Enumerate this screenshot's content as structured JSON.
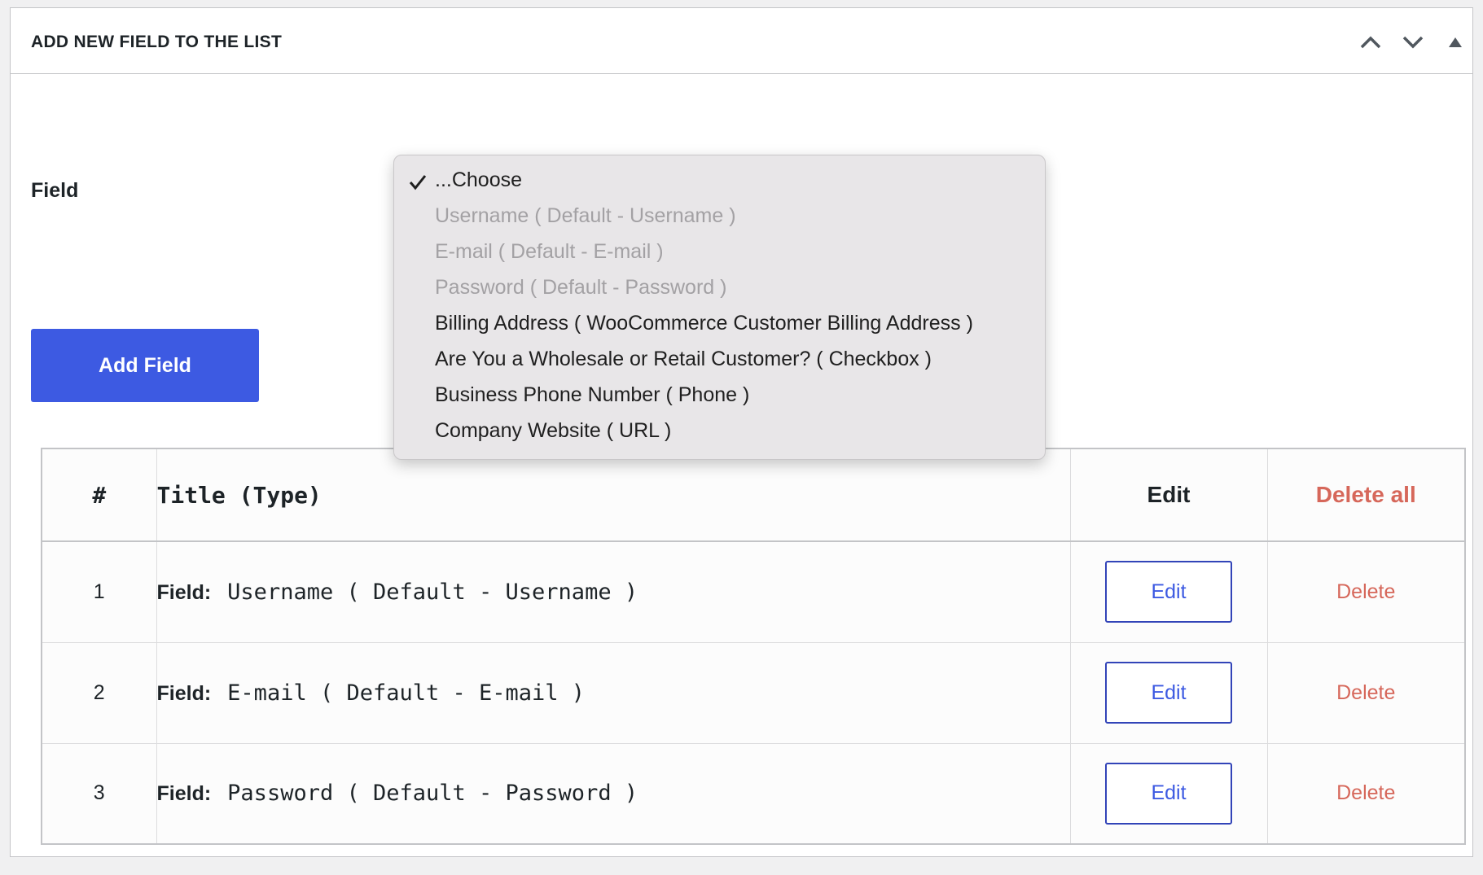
{
  "panel": {
    "title": "ADD NEW FIELD TO THE LIST",
    "controls": [
      "chevron-up-icon",
      "chevron-down-icon",
      "triangle-up-icon"
    ]
  },
  "form": {
    "field_label": "Field",
    "add_button": "Add Field"
  },
  "dropdown": {
    "selected": "...Choose",
    "options": [
      {
        "label": "...Choose",
        "checked": true,
        "disabled": false
      },
      {
        "label": "Username ( Default - Username )",
        "checked": false,
        "disabled": true
      },
      {
        "label": "E-mail ( Default - E-mail )",
        "checked": false,
        "disabled": true
      },
      {
        "label": "Password ( Default - Password )",
        "checked": false,
        "disabled": true
      },
      {
        "label": "Billing Address ( WooCommerce Customer Billing Address )",
        "checked": false,
        "disabled": false
      },
      {
        "label": "Are You a Wholesale or Retail Customer? ( Checkbox )",
        "checked": false,
        "disabled": false
      },
      {
        "label": "Business Phone Number ( Phone )",
        "checked": false,
        "disabled": false
      },
      {
        "label": "Company Website ( URL )",
        "checked": false,
        "disabled": false
      }
    ]
  },
  "table": {
    "headers": {
      "num": "#",
      "title": "Title (Type)",
      "edit": "Edit",
      "delete_all": "Delete all"
    },
    "rows": [
      {
        "num": "1",
        "prefix": "Field:",
        "value": "Username ( Default - Username )",
        "edit": "Edit",
        "delete": "Delete"
      },
      {
        "num": "2",
        "prefix": "Field:",
        "value": "E-mail ( Default - E-mail )",
        "edit": "Edit",
        "delete": "Delete"
      },
      {
        "num": "3",
        "prefix": "Field:",
        "value": "Password ( Default - Password )",
        "edit": "Edit",
        "delete": "Delete"
      }
    ]
  },
  "colors": {
    "primary": "#3d5ae2",
    "delete": "#d6675a",
    "dropdown_bg": "#e8e6e8",
    "disabled_text": "#a3a1a4"
  }
}
